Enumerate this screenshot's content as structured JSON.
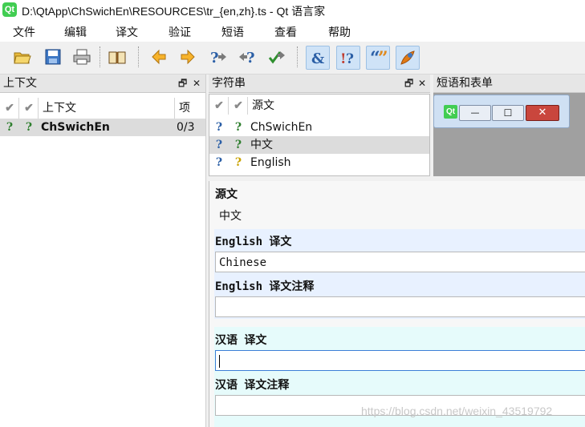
{
  "window": {
    "title": "D:\\QtApp\\ChSwichEn\\RESOURCES\\tr_{en,zh}.ts - Qt 语言家",
    "logo_text": "Qt"
  },
  "menu": [
    "文件",
    "编辑",
    "译文",
    "验证",
    "短语",
    "查看",
    "帮助"
  ],
  "toolbar": {
    "buttons": [
      "open-icon",
      "save-icon",
      "print-icon",
      "phrasebook-icon",
      "prev-icon",
      "next-icon",
      "prev-unfinished-icon",
      "next-unfinished-icon",
      "done-next-icon",
      "accelerator-check-icon",
      "punctuation-check-icon",
      "phrase-check-icon",
      "placemarker-check-icon"
    ]
  },
  "context_pane": {
    "title": "上下文",
    "float_glyph": "🗗",
    "close_glyph": "✕",
    "header": {
      "check1": "✔",
      "check2": "✔",
      "context": "上下文",
      "items": "项"
    },
    "rows": [
      {
        "icon1": "?",
        "icon2": "?",
        "name": "ChSwichEn",
        "items": "0/3"
      }
    ]
  },
  "strings_pane": {
    "title": "字符串",
    "float_glyph": "🗗",
    "close_glyph": "✕",
    "header": {
      "check1": "✔",
      "check2": "✔",
      "source": "源文"
    },
    "rows": [
      {
        "icon1": "?",
        "icon2": "?",
        "text": "ChSwichEn"
      },
      {
        "icon1": "?",
        "icon2": "?",
        "text": "中文"
      },
      {
        "icon1": "?",
        "icon2": "?",
        "text": "English"
      }
    ]
  },
  "phrases_pane": {
    "title": "短语和表单",
    "qt_label": "Qt",
    "minimize": "—",
    "maximize": "☐",
    "close": "✕"
  },
  "editor": {
    "source_label": "源文",
    "source_text": "中文",
    "english_label": "English 译文",
    "english_value": "Chinese",
    "english_comment_label": "English 译文注释",
    "english_comment_value": "",
    "chinese_label": "汉语 译文",
    "chinese_value": "",
    "chinese_comment_label": "汉语 译文注释",
    "chinese_comment_value": ""
  },
  "watermark": "https://blog.csdn.net/weixin_43519792"
}
